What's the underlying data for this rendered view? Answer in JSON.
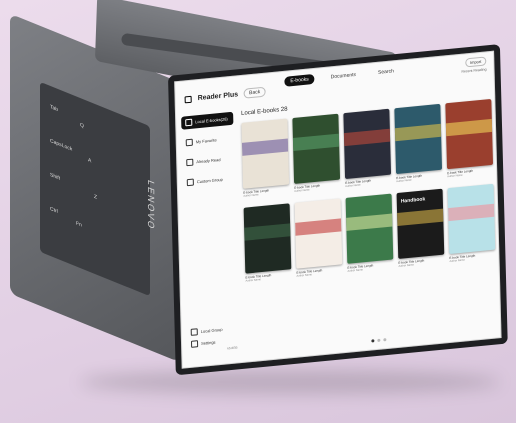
{
  "device": {
    "brand_logo": "LENOVO"
  },
  "app": {
    "title": "Reader Plus",
    "back_label": "Back",
    "tabs": [
      "E-books",
      "Documents",
      "Search"
    ],
    "import_label": "Import",
    "sort_text": "Recent Reading"
  },
  "sidebar": {
    "items": [
      "Local E-books(28)",
      "My Favorite",
      "Already Read",
      "Custom Group"
    ],
    "bottom": [
      "Local Group",
      "Settings"
    ],
    "storage": "65.8GB"
  },
  "section": {
    "title": "Local E-books 28"
  },
  "books": [
    {
      "meta": "E-book Title Length",
      "sub": "Author Name",
      "color": "#e9e2d6",
      "accent": "#6a5a9b"
    },
    {
      "meta": "E-book Title Length",
      "sub": "Author Name",
      "color": "#2f4f2f",
      "accent": "#5aa06a"
    },
    {
      "meta": "E-book Title Length",
      "sub": "Author Name",
      "color": "#2a2d3a",
      "accent": "#c04a3a"
    },
    {
      "meta": "E-book Title Length",
      "sub": "Author Name",
      "color": "#2d5a6b",
      "accent": "#e0c24a"
    },
    {
      "meta": "E-book Title Length",
      "sub": "Author Name",
      "color": "#9a3f2e",
      "accent": "#f0d35a"
    },
    {
      "meta": "E-book Title Length",
      "sub": "Author Name",
      "color": "#1f2a23",
      "accent": "#3f6b4a"
    },
    {
      "meta": "E-book Title Length",
      "sub": "Author Name",
      "color": "#f4ede6",
      "accent": "#c23b3b"
    },
    {
      "meta": "E-book Title Length",
      "sub": "Author Name",
      "color": "#3c7a4a",
      "accent": "#d7e6a0"
    },
    {
      "meta": "E-book Title Length",
      "sub": "Author Name",
      "color": "#1b1b1b",
      "accent": "#d6b24a",
      "title": "Handbook"
    },
    {
      "meta": "E-book Title Length",
      "sub": "Author Name",
      "color": "#b8e1e8",
      "accent": "#f28f9a"
    }
  ],
  "keys": [
    "Tab",
    "Q",
    "CapsLock",
    "A",
    "Shift",
    "Z",
    "Ctrl",
    "Fn"
  ]
}
